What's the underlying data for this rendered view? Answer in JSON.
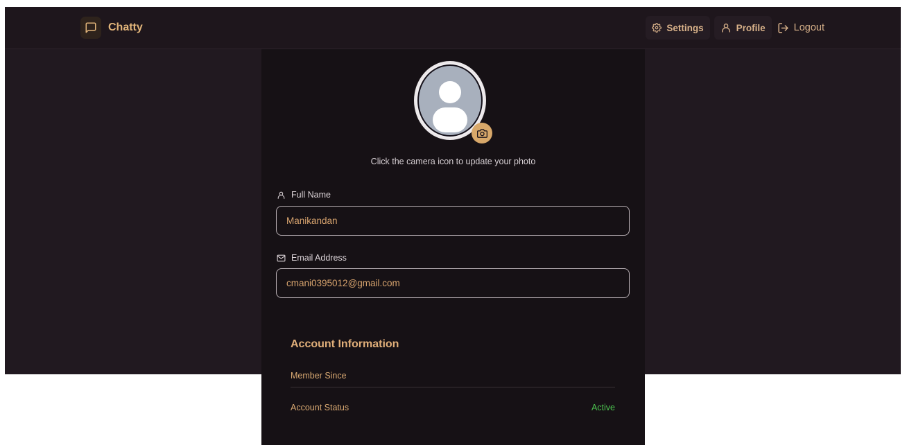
{
  "navbar": {
    "brand_name": "Chatty",
    "settings_label": "Settings",
    "profile_label": "Profile",
    "logout_label": "Logout"
  },
  "profile": {
    "photo_hint": "Click the camera icon to update your photo",
    "full_name_label": "Full Name",
    "full_name_value": "Manikandan",
    "email_label": "Email Address",
    "email_value": "cmani0395012@gmail.com"
  },
  "account_info": {
    "title": "Account Information",
    "member_since_label": "Member Since",
    "member_since_value": "",
    "status_label": "Account Status",
    "status_value": "Active"
  },
  "colors": {
    "accent": "#e2b57a",
    "background": "#211920",
    "card": "#161115",
    "status_active": "#4cc24f"
  },
  "icons": {
    "brand": "message-square-icon",
    "settings": "gear-icon",
    "profile": "user-icon",
    "logout": "logout-icon",
    "camera": "camera-icon",
    "full_name": "user-icon",
    "email": "mail-icon"
  }
}
